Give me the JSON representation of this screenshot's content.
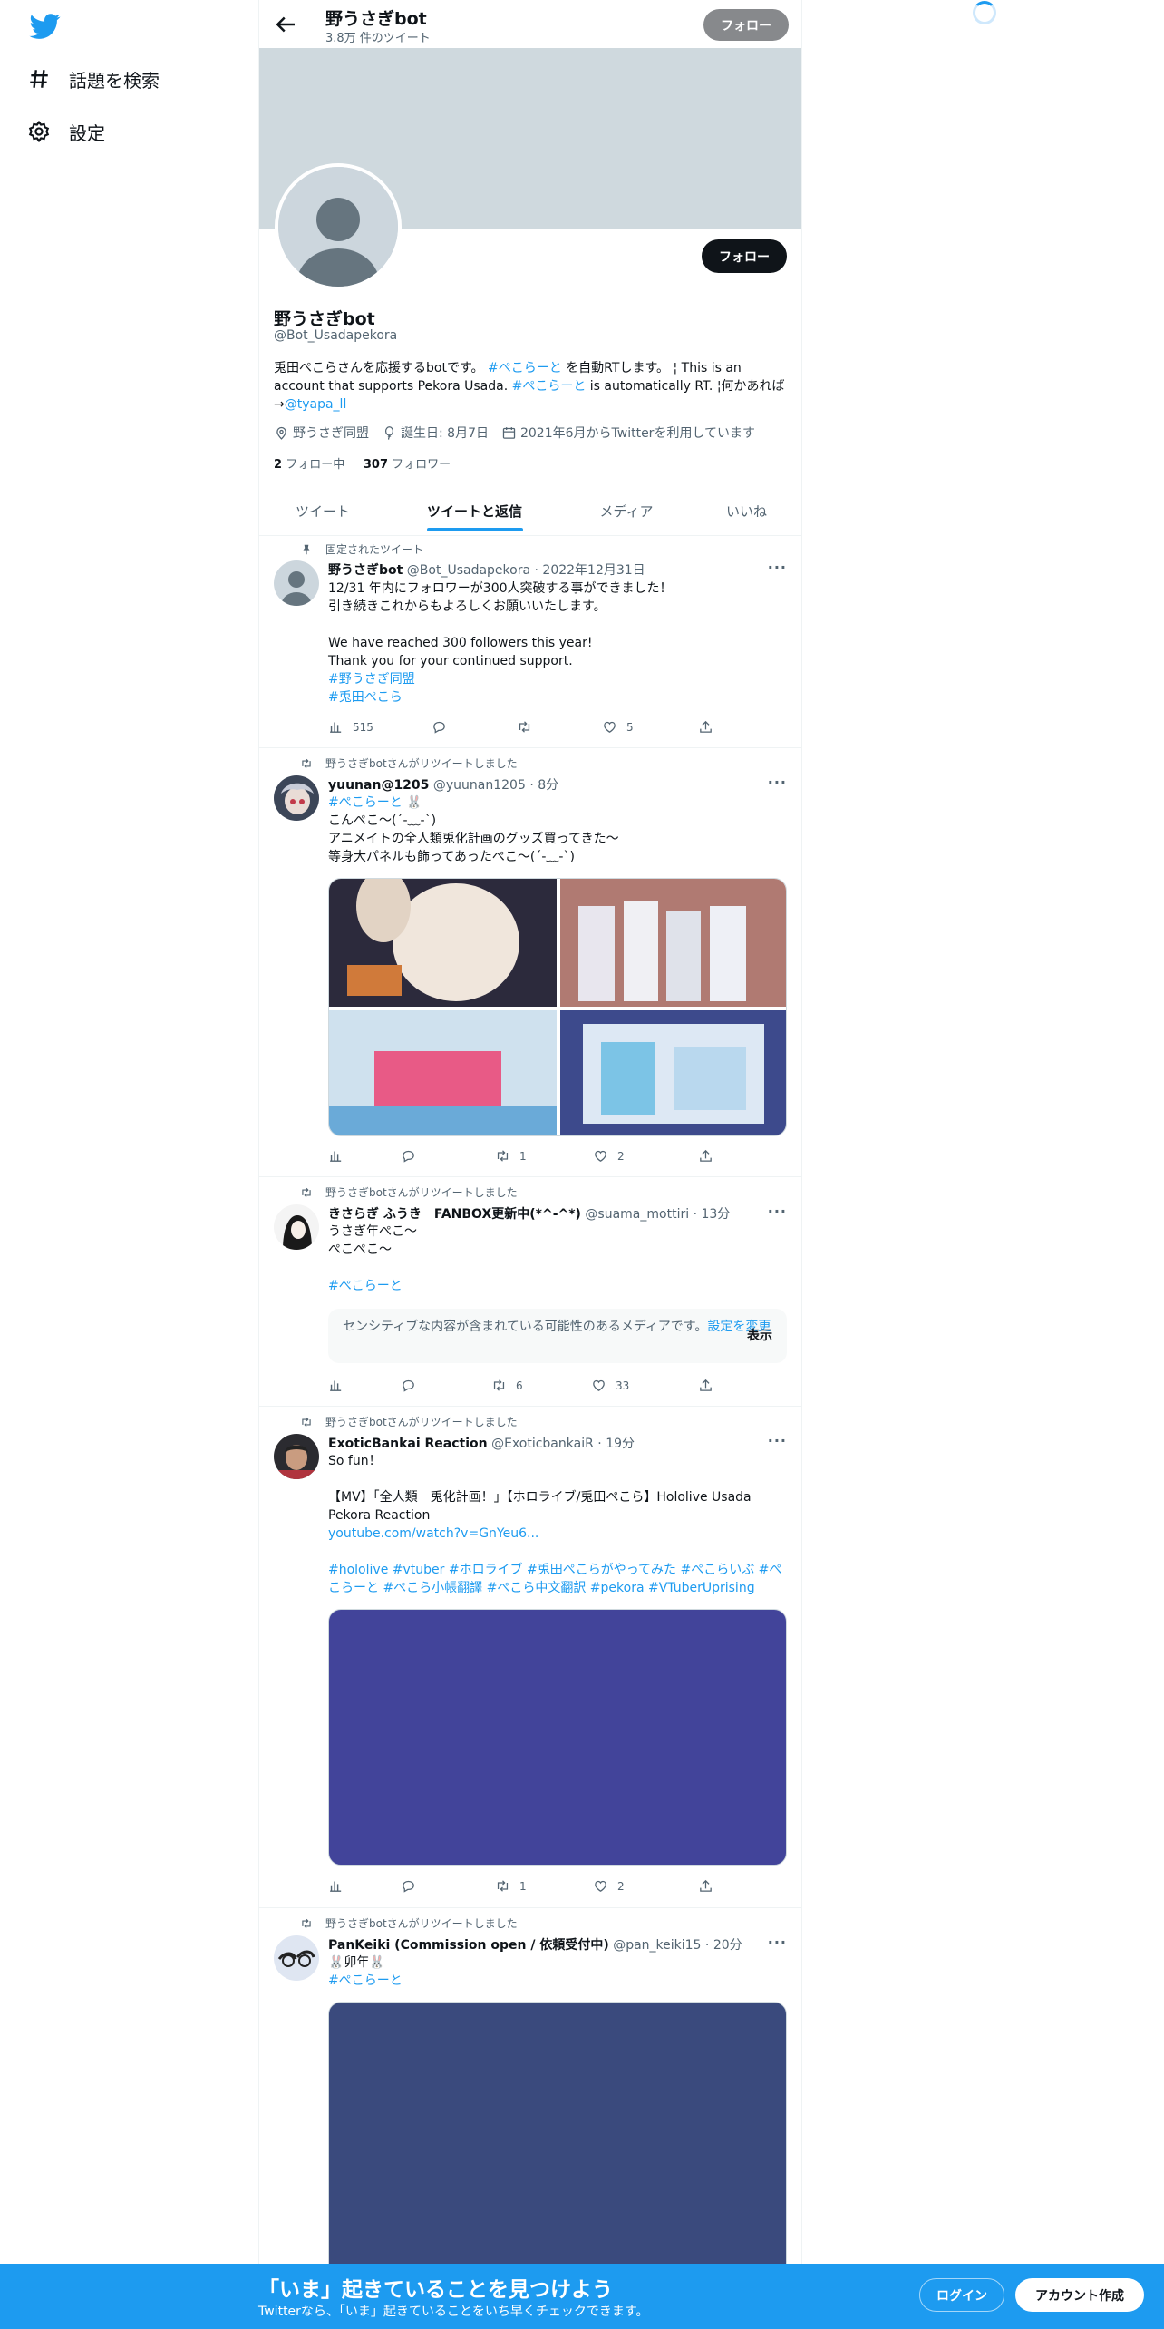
{
  "nav": {
    "explore_label": "話題を検索",
    "settings_label": "設定"
  },
  "topbar": {
    "name": "野うさぎbot",
    "tweet_count": "3.8万 件のツイート",
    "follow_label": "フォロー"
  },
  "profile": {
    "name": "野うさぎbot",
    "handle": "@Bot_Usadapekora",
    "follow_label": "フォロー",
    "bio": {
      "p1": "兎田ぺこらさんを応援するbotです。",
      "tag1": "#ぺこらーと",
      "p2": "を自動RTします。 ¦ This is an account that supports Pekora Usada.",
      "tag2": "#ぺこらーと",
      "p3": "is automatically RT. ¦何かあれば→",
      "mention": "@tyapa_ll"
    },
    "location": "野うさぎ同盟",
    "birthday": "誕生日: 8月7日",
    "joined": "2021年6月からTwitterを利用しています",
    "following_count": "2",
    "following_label": "フォロー中",
    "followers_count": "307",
    "followers_label": "フォロワー"
  },
  "tabs": [
    "ツイート",
    "ツイートと返信",
    "メディア",
    "いいね"
  ],
  "tweets": [
    {
      "context": "固定されたツイート",
      "name": "野うさぎbot",
      "handle": "@Bot_Usadapekora",
      "time": "2022年12月31日",
      "lines": [
        "12/31 年内にフォロワーが300人突破する事ができました！",
        "引き続きこれからもよろしくお願いいたします。",
        "",
        "We have reached 300 followers this year!",
        "Thank you for your continued support."
      ],
      "tags": [
        "#野うさぎ同盟",
        "#兎田ぺこら"
      ],
      "views": "515",
      "replies": "",
      "retweets": "",
      "likes": "5"
    },
    {
      "context": "野うさぎbotさんがリツイートしました",
      "name": "yuunan@1205",
      "handle": "@yuunan1205",
      "time": "8分",
      "tag_line": "#ぺこらーと",
      "lines": [
        "こんぺこ～(´-﹏-`)",
        "アニメイトの全人類兎化計画のグッズ買ってきた～",
        "等身大パネルも飾ってあったぺこ～(´-﹏-`)"
      ],
      "views": "",
      "replies": "",
      "retweets": "1",
      "likes": "2"
    },
    {
      "context": "野うさぎbotさんがリツイートしました",
      "name": "きさらぎ ふうき　FANBOX更新中(*^-^*)",
      "handle": "@suama_mottiri",
      "time": "13分",
      "lines": [
        "うさぎ年ぺこ～",
        "ぺこぺこ～"
      ],
      "tag": "#ぺこらーと",
      "sensitive_text": "センシティブな内容が含まれている可能性のあるメディアです。",
      "sensitive_link": "設定を変更",
      "sensitive_show": "表示",
      "views": "",
      "replies": "",
      "retweets": "6",
      "likes": "33"
    },
    {
      "context": "野うさぎbotさんがリツイートしました",
      "name": "ExoticBankai Reaction",
      "handle": "@ExoticbankaiR",
      "time": "19分",
      "line1": "So fun！",
      "line2": "【MV】「全人類　兎化計画！」【ホロライブ/兎田ぺこら】Hololive Usada Pekora Reaction",
      "url": "youtube.com/watch?v=GnYeu6...",
      "tags": "#hololive #vtuber #ホロライブ #兎田ぺこらがやってみた #ぺこらいぶ #ぺこらーと #ぺこら小帳翻譯 #ぺこら中文翻訳 #pekora #VTuberUprising",
      "views": "",
      "replies": "",
      "retweets": "1",
      "likes": "2"
    },
    {
      "context": "野うさぎbotさんがリツイートしました",
      "name": "PanKeiki (Commission open / 依頼受付中)",
      "handle": "@pan_keiki15",
      "time": "20分",
      "line1": "🐰卯年🐰",
      "tag": "#ぺこらーと"
    }
  ],
  "colors": {
    "accent": "#1d9bf0",
    "media_purple": "#42449a",
    "media_navy": "#3a4a7d"
  },
  "bottom_bar": {
    "title": "「いま」起きていることを見つけよう",
    "subtitle": "Twitterなら、「いま」起きていることをいち早くチェックできます。",
    "login": "ログイン",
    "signup": "アカウント作成"
  }
}
